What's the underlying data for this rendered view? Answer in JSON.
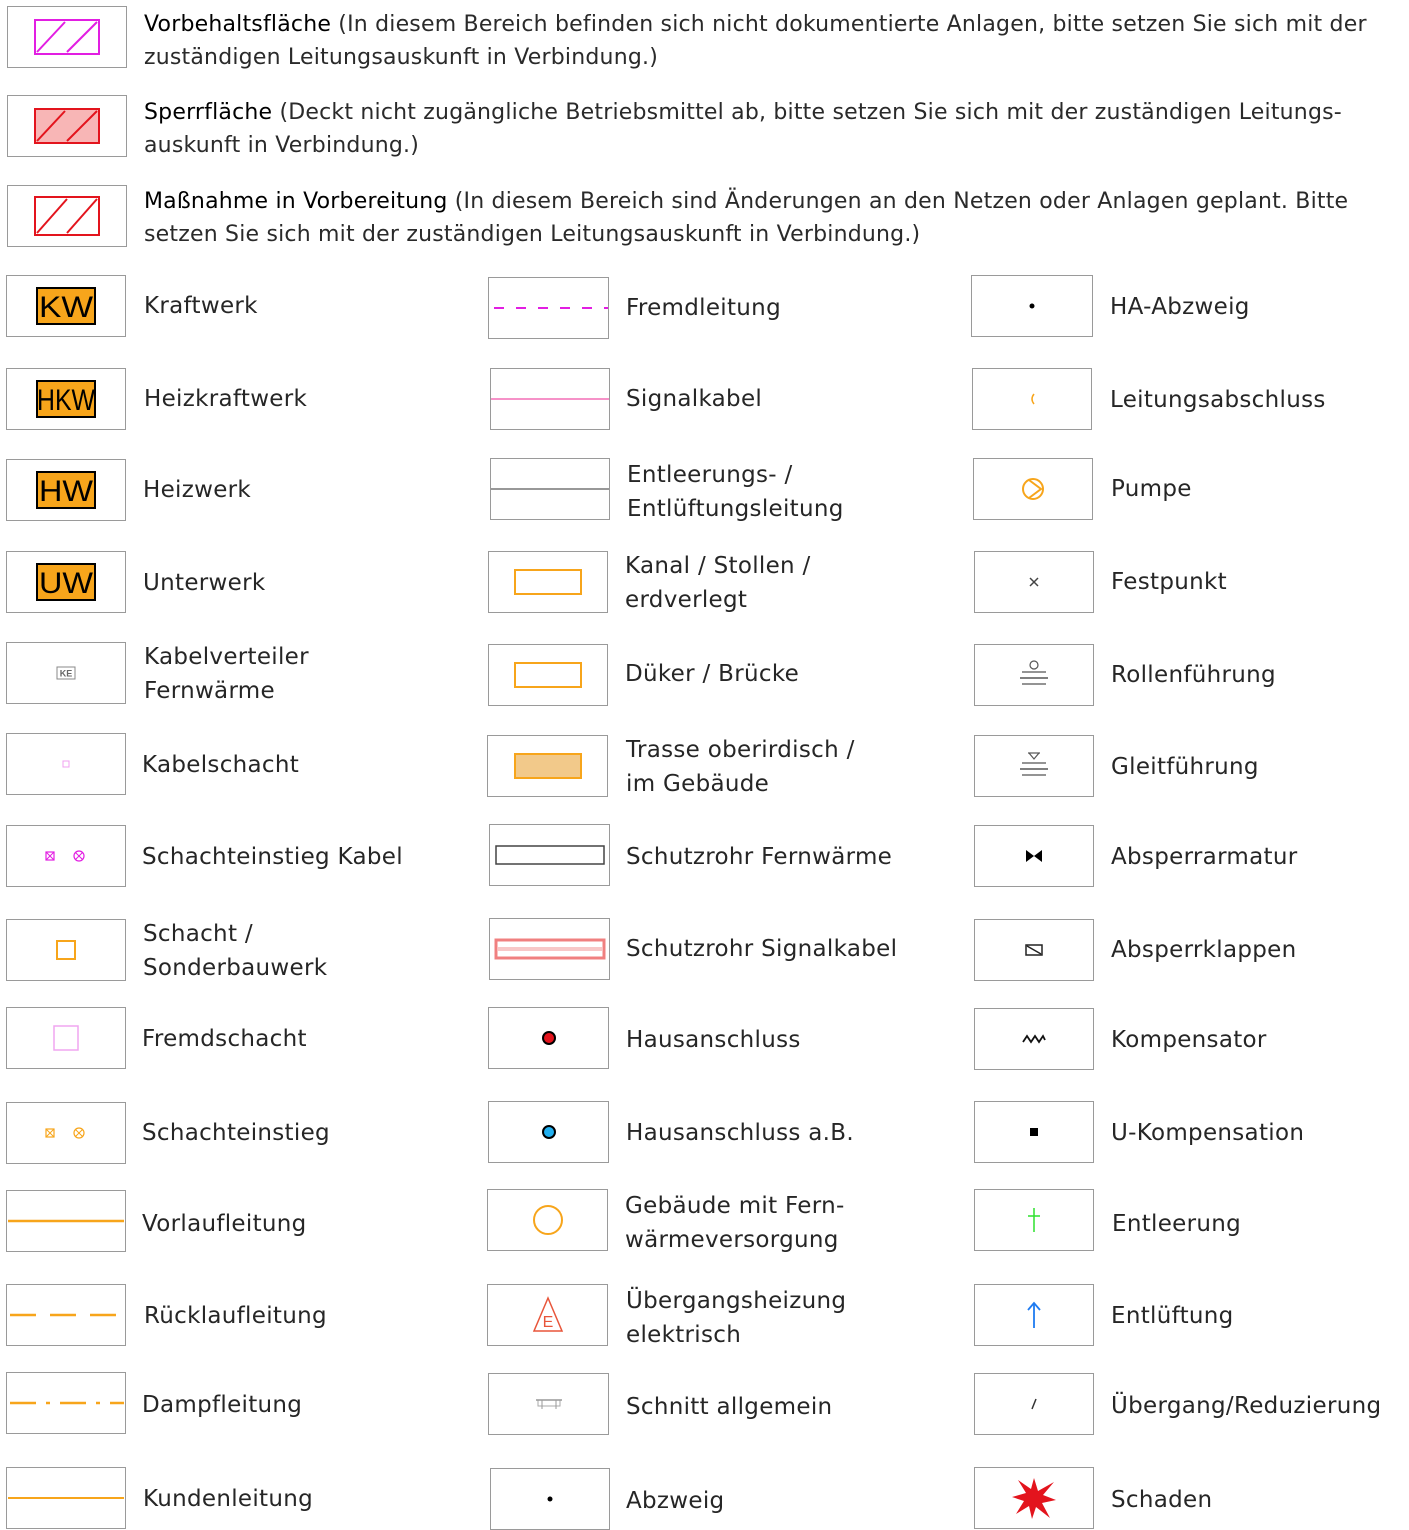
{
  "areas": [
    {
      "term": "Vorbehaltsfläche",
      "desc": " (In diesem Bereich befinden sich nicht dokumentierte Anlagen, bitte setzen Sie sich mit der zuständigen Leitungsauskunft in Verbindung.)",
      "icon": "hatched-area-magenta-icon"
    },
    {
      "term": "Sperrfläche",
      "desc": " (Deckt nicht zugängliche Betriebsmittel ab, bitte setzen Sie sich mit der zuständigen Leitungs-auskunft in Verbindung.)",
      "icon": "hatched-area-red-filled-icon"
    },
    {
      "term": "Maßnahme in Vorbereitung",
      "desc": " (In diesem Bereich sind Änderungen an den Netzen oder Anlagen geplant. Bitte setzen Sie sich mit der zuständigen Leitungsauskunft in Verbindung.)",
      "icon": "hatched-area-red-icon"
    }
  ],
  "legend": {
    "col1": [
      {
        "label": "Kraftwerk",
        "icon": "kw-icon"
      },
      {
        "label": "Heizkraftwerk",
        "icon": "hkw-icon"
      },
      {
        "label": "Heizwerk",
        "icon": "hw-icon"
      },
      {
        "label": "Unterwerk",
        "icon": "uw-icon"
      },
      {
        "label": "Kabelverteiler Fernwärme",
        "icon": "ke-icon"
      },
      {
        "label": "Kabelschacht",
        "icon": "small-magenta-square-icon"
      },
      {
        "label": "Schachteinstieg Kabel",
        "icon": "magenta-manhole-entry-icon"
      },
      {
        "label": "Schacht / Sonderbauwerk",
        "icon": "orange-square-icon"
      },
      {
        "label": "Fremdschacht",
        "icon": "magenta-square-icon"
      },
      {
        "label": "Schachteinstieg",
        "icon": "orange-manhole-entry-icon"
      },
      {
        "label": "Vorlaufleitung",
        "icon": "orange-solid-line-icon"
      },
      {
        "label": "Rücklaufleitung",
        "icon": "orange-dashed-line-icon"
      },
      {
        "label": "Dampfleitung",
        "icon": "orange-dash-dot-line-icon"
      },
      {
        "label": "Kundenleitung",
        "icon": "orange-thin-line-icon"
      }
    ],
    "col2": [
      {
        "label": "Fremdleitung",
        "icon": "magenta-dashed-line-icon"
      },
      {
        "label": "Signalkabel",
        "icon": "pink-line-icon"
      },
      {
        "label": "Entleerungs- / Entlüftungsleitung",
        "icon": "gray-line-icon"
      },
      {
        "label": "Kanal / Stollen / erdverlegt",
        "icon": "orange-outline-rect-icon"
      },
      {
        "label": "Düker / Brücke",
        "icon": "orange-outline-rect-icon"
      },
      {
        "label": "Trasse oberirdisch / im Gebäude",
        "icon": "orange-filled-rect-icon"
      },
      {
        "label": "Schutzrohr Fernwärme",
        "icon": "gray-pipe-icon"
      },
      {
        "label": "Schutzrohr Signalkabel",
        "icon": "red-pipe-icon"
      },
      {
        "label": "Hausanschluss",
        "icon": "red-dot-icon"
      },
      {
        "label": "Hausanschluss a.B.",
        "icon": "blue-dot-icon"
      },
      {
        "label": "Gebäude mit Fern- wärmeversorgung",
        "icon": "orange-circle-icon"
      },
      {
        "label": "Übergangsheizung elektrisch",
        "icon": "warning-e-icon"
      },
      {
        "label": "Schnitt allgemein",
        "icon": "section-mark-icon"
      },
      {
        "label": "Abzweig",
        "icon": "black-dot-icon"
      }
    ],
    "col3": [
      {
        "label": "HA-Abzweig",
        "icon": "black-dot-icon"
      },
      {
        "label": "Leitungsabschluss",
        "icon": "line-end-icon"
      },
      {
        "label": "Pumpe",
        "icon": "pump-icon"
      },
      {
        "label": "Festpunkt",
        "icon": "cross-icon"
      },
      {
        "label": "Rollenführung",
        "icon": "roller-guide-icon"
      },
      {
        "label": "Gleitführung",
        "icon": "slide-guide-icon"
      },
      {
        "label": "Absperrarmatur",
        "icon": "valve-icon"
      },
      {
        "label": "Absperrklappen",
        "icon": "butterfly-valve-icon"
      },
      {
        "label": "Kompensator",
        "icon": "compensator-icon"
      },
      {
        "label": "U-Kompensation",
        "icon": "black-square-icon"
      },
      {
        "label": "Entleerung",
        "icon": "green-plus-icon"
      },
      {
        "label": "Entlüftung",
        "icon": "blue-arrow-icon"
      },
      {
        "label": "Übergang/Reduzierung",
        "icon": "slash-icon"
      },
      {
        "label": "Schaden",
        "icon": "red-star-icon"
      }
    ]
  },
  "colors": {
    "orange": "#f7a51b",
    "magenta": "#e21ee2",
    "red": "#e3141d",
    "pink": "#f36fb5",
    "blue": "#1e7bf1"
  }
}
